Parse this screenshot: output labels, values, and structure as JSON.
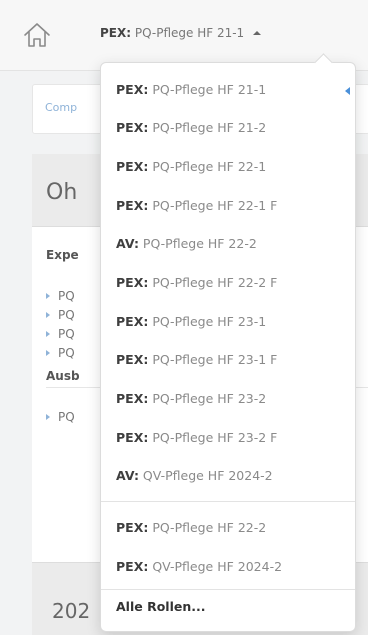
{
  "header": {
    "role_prefix": "PEX:",
    "role_name": "PQ-Pflege HF 21-1"
  },
  "background": {
    "comp_link": "Comp",
    "main_title": "Oh",
    "section_expe": "Expe",
    "expe_items": [
      "PQ",
      "PQ",
      "PQ",
      "PQ"
    ],
    "section_ausb": "Ausb",
    "ausb_items": [
      "PQ"
    ],
    "year_title": "202"
  },
  "dropdown": {
    "items": [
      {
        "prefix": "PEX:",
        "name": "PQ-Pflege HF 21-1",
        "active": true
      },
      {
        "prefix": "PEX:",
        "name": "PQ-Pflege HF 21-2"
      },
      {
        "prefix": "PEX:",
        "name": "PQ-Pflege HF 22-1"
      },
      {
        "prefix": "PEX:",
        "name": "PQ-Pflege HF 22-1 F"
      },
      {
        "prefix": "AV:",
        "name": "PQ-Pflege HF 22-2"
      },
      {
        "prefix": "PEX:",
        "name": "PQ-Pflege HF 22-2 F"
      },
      {
        "prefix": "PEX:",
        "name": "PQ-Pflege HF 23-1"
      },
      {
        "prefix": "PEX:",
        "name": "PQ-Pflege HF 23-1 F"
      },
      {
        "prefix": "PEX:",
        "name": "PQ-Pflege HF 23-2"
      },
      {
        "prefix": "PEX:",
        "name": "PQ-Pflege HF 23-2 F"
      },
      {
        "prefix": "AV:",
        "name": "QV-Pflege HF 2024-2"
      }
    ],
    "secondary_items": [
      {
        "prefix": "PEX:",
        "name": "PQ-Pflege HF 22-2"
      },
      {
        "prefix": "PEX:",
        "name": "QV-Pflege HF 2024-2"
      }
    ],
    "all_roles_label": "Alle Rollen..."
  },
  "colors": {
    "accent": "#4a90d9",
    "link": "#8fb3d8"
  },
  "icons": {
    "home": "home-icon",
    "caret": "caret-up-icon",
    "active_marker": "caret-left-icon",
    "bullet": "triangle-right-icon"
  }
}
